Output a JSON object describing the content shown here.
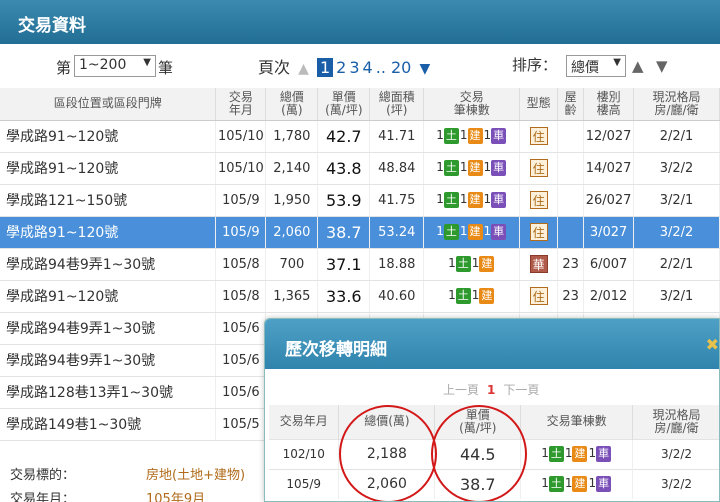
{
  "window": {
    "title": "交易資料"
  },
  "controls": {
    "page_prefix": "第",
    "page_range": "1~200",
    "page_suffix": "筆",
    "pager_label": "頁次",
    "pages": [
      "1",
      "2",
      "3",
      "4",
      ".. 20"
    ],
    "current_page": "1",
    "sort_label": "排序：",
    "sort_value": "總價"
  },
  "table": {
    "headers": [
      "區段位置或區段門牌",
      "交易\n年月",
      "總價\n(萬)",
      "單價\n(萬/坪)",
      "總面積\n(坪)",
      "交易\n筆棟數",
      "型態",
      "屋\n齡",
      "樓別\n樓高",
      "現況格局\n房/廳/衛"
    ],
    "badge_labels": {
      "land": "土",
      "bldg": "建",
      "car": "車"
    },
    "rows": [
      {
        "addr": "學成路91~120號",
        "date": "105/10",
        "total": "1,780",
        "unit": "42.7",
        "area": "41.71",
        "land": "1",
        "bldg": "1",
        "car": "1",
        "type": "住",
        "age": "",
        "floor": "12/027",
        "layout": "2/2/1"
      },
      {
        "addr": "學成路91~120號",
        "date": "105/10",
        "total": "2,140",
        "unit": "43.8",
        "area": "48.84",
        "land": "1",
        "bldg": "1",
        "car": "1",
        "type": "住",
        "age": "",
        "floor": "14/027",
        "layout": "3/2/2"
      },
      {
        "addr": "學成路121~150號",
        "date": "105/9",
        "total": "1,950",
        "unit": "53.9",
        "area": "41.75",
        "land": "1",
        "bldg": "1",
        "car": "1",
        "type": "住",
        "age": "",
        "floor": "26/027",
        "layout": "3/2/1"
      },
      {
        "addr": "學成路91~120號",
        "date": "105/9",
        "total": "2,060",
        "unit": "38.7",
        "area": "53.24",
        "land": "1",
        "bldg": "1",
        "car": "1",
        "type": "住",
        "age": "",
        "floor": "3/027",
        "layout": "3/2/2"
      },
      {
        "addr": "學成路94巷9弄1~30號",
        "date": "105/8",
        "total": "700",
        "unit": "37.1",
        "area": "18.88",
        "land": "1",
        "bldg": "1",
        "car": "",
        "type": "華",
        "age": "23",
        "floor": "6/007",
        "layout": "2/2/1"
      },
      {
        "addr": "學成路91~120號",
        "date": "105/8",
        "total": "1,365",
        "unit": "33.6",
        "area": "40.60",
        "land": "1",
        "bldg": "1",
        "car": "",
        "type": "住",
        "age": "23",
        "floor": "2/012",
        "layout": "3/2/1"
      },
      {
        "addr": "學成路94巷9弄1~30號",
        "date": "105/6"
      },
      {
        "addr": "學成路94巷9弄1~30號",
        "date": "105/6"
      },
      {
        "addr": "學成路128巷13弄1~30號",
        "date": "105/6"
      },
      {
        "addr": "學成路149巷1~30號",
        "date": "105/5"
      }
    ]
  },
  "info": {
    "type_label": "交易標的：",
    "type_value": "房地(土地+建物)",
    "date_label": "交易年月：",
    "date_value": "105年9月"
  },
  "popup": {
    "title": "歷次移轉明細",
    "prev": "上一頁",
    "page": "1",
    "next": "下一頁",
    "headers": [
      "交易年月",
      "總價(萬)",
      "單價\n(萬/坪)",
      "交易筆棟數",
      "現況格局\n房/廳/衛"
    ],
    "rows": [
      {
        "date": "102/10",
        "total": "2,188",
        "unit": "44.5",
        "land": "1",
        "bldg": "1",
        "car": "1",
        "layout": "3/2/2"
      },
      {
        "date": "105/9",
        "total": "2,060",
        "unit": "38.7",
        "land": "1",
        "bldg": "1",
        "car": "1",
        "layout": "3/2/2"
      }
    ]
  }
}
